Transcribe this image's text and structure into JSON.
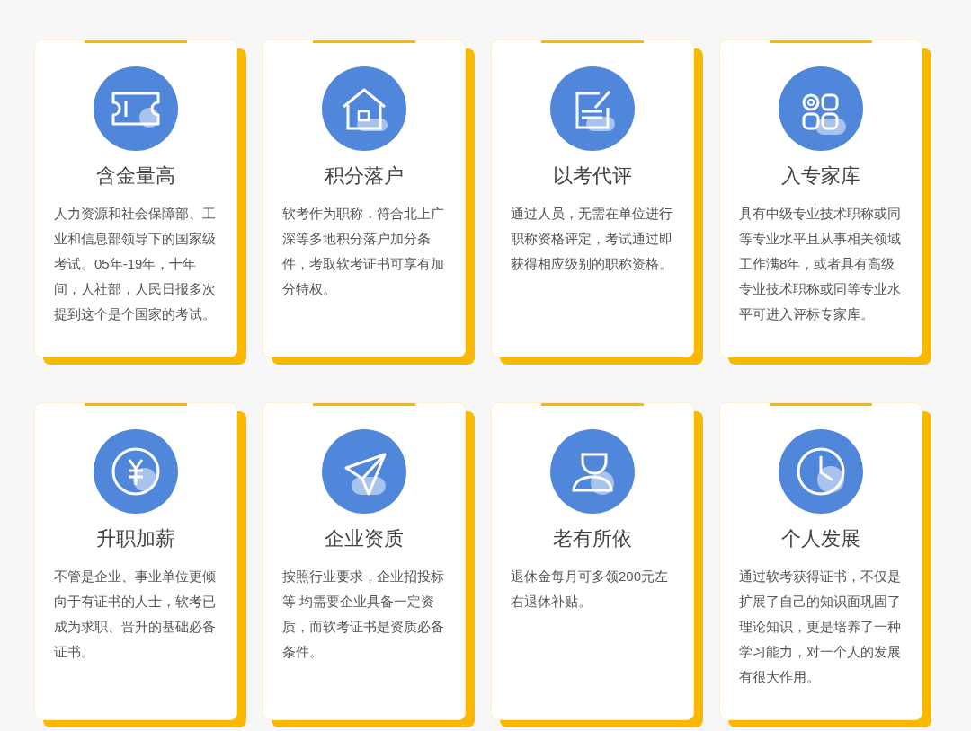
{
  "cards": [
    {
      "title": "含金量高",
      "text": "人力资源和社会保障部、工业和信息部领导下的国家级考试。05年-19年，十年间，人社部，人民日报多次提到这个是个国家的考试。"
    },
    {
      "title": "积分落户",
      "text": "软考作为职称，符合北上广深等多地积分落户加分条件，考取软考证书可享有加分特权。"
    },
    {
      "title": "以考代评",
      "text": "通过人员，无需在单位进行职称资格评定，考试通过即获得相应级别的职称资格。"
    },
    {
      "title": "入专家库",
      "text": "具有中级专业技术职称或同等专业水平且从事相关领域工作满8年，或者具有高级专业技术职称或同等专业水平可进入评标专家库。"
    },
    {
      "title": "升职加薪",
      "text": "不管是企业、事业单位更倾向于有证书的人士，软考已成为求职、晋升的基础必备证书。"
    },
    {
      "title": "企业资质",
      "text": "按照行业要求，企业招投标等 均需要企业具备一定资质，而软考证书是资质必备条件。"
    },
    {
      "title": "老有所依",
      "text": "退休金每月可多领200元左右退休补贴。"
    },
    {
      "title": "个人发展",
      "text": "通过软考获得证书，不仅是扩展了自己的知识面巩固了理论知识，更是培养了一种学习能力，对一个人的发展有很大作用。"
    }
  ]
}
